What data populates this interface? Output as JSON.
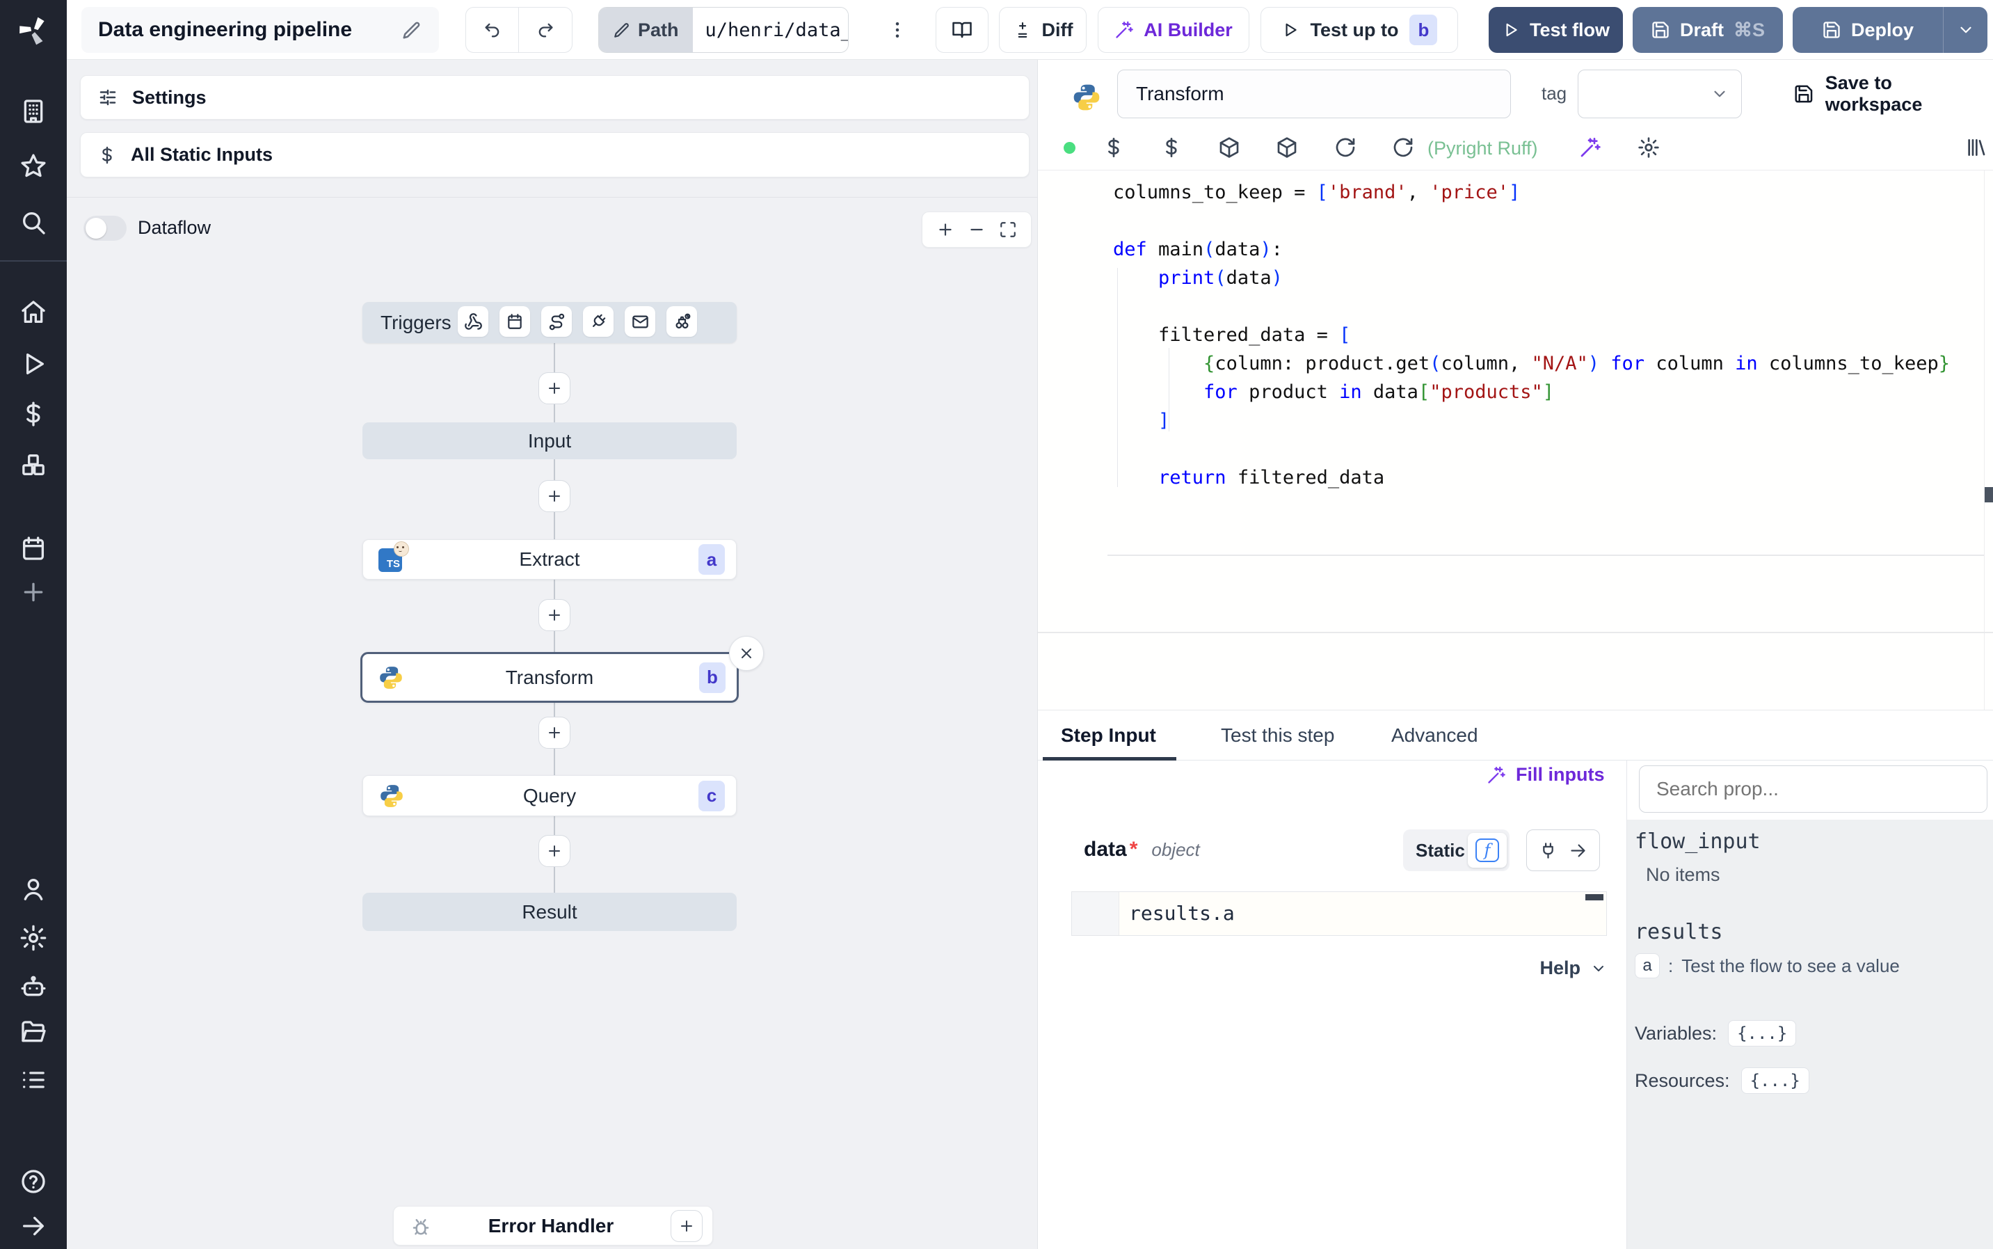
{
  "colors": {
    "test_flow_bg": "#3b4d71",
    "deploy_bg": "#5e7497",
    "ai_purple": "#6d28d9",
    "lint_green": "#79c093",
    "badge_bg": "#dbe3fc",
    "badge_text": "#4338ca",
    "status_dot": "#4ade80",
    "selected_node_border": "#51607a"
  },
  "sidebar": {
    "icons": [
      "windmill-logo",
      "workspace-building",
      "favorites-star",
      "search",
      "home",
      "runs-play",
      "variables-dollar",
      "resources-cubes",
      "schedules-calendar",
      "add-plus",
      "user",
      "settings-gear",
      "workers-robot",
      "folders",
      "audit-list",
      "help",
      "expand-arrow"
    ]
  },
  "topbar": {
    "title": "Data engineering pipeline",
    "path_label": "Path",
    "path_value": "u/henri/data_",
    "diff": "Diff",
    "ai_builder": "AI Builder",
    "test_up_to": "Test up to",
    "test_up_to_badge": "b",
    "test_flow": "Test flow",
    "draft": "Draft",
    "draft_shortcut": "⌘S",
    "deploy": "Deploy"
  },
  "flow_panel": {
    "settings": "Settings",
    "all_static_inputs": "All Static Inputs",
    "dataflow": "Dataflow",
    "trigger_icons": [
      "webhook-icon",
      "schedule-icon",
      "route-icon",
      "websocket-icon",
      "email-icon",
      "scheduled-poll-icon"
    ],
    "nodes": {
      "triggers": "Triggers",
      "input": "Input",
      "extract": {
        "label": "Extract",
        "badge": "a"
      },
      "transform": {
        "label": "Transform",
        "badge": "b"
      },
      "query": {
        "label": "Query",
        "badge": "c"
      },
      "result": "Result",
      "error_handler": "Error Handler"
    }
  },
  "editor": {
    "step_name": "Transform",
    "tag_label": "tag",
    "save_label": "Save to workspace",
    "lint": "(Pyright Ruff)",
    "toolbar_icons": [
      "status-dot",
      "variable-dollar",
      "variable-dollar-2",
      "package-box",
      "package-box-2",
      "reload",
      "reload-2",
      "ai-wand",
      "gear",
      "library-columns"
    ],
    "code_lines": [
      [
        [
          "columns_to_keep = ",
          "pl"
        ],
        [
          "[",
          "b1"
        ],
        [
          "'brand'",
          "str"
        ],
        [
          ", ",
          "pl"
        ],
        [
          "'price'",
          "str"
        ],
        [
          "]",
          "b1"
        ]
      ],
      [],
      [
        [
          "def",
          "kw"
        ],
        [
          " main",
          "pl"
        ],
        [
          "(",
          "b1"
        ],
        [
          "data",
          "pl"
        ],
        [
          ")",
          "b1"
        ],
        [
          ":",
          "pl"
        ]
      ],
      [
        [
          "    ",
          "pl"
        ],
        [
          "print",
          "kw"
        ],
        [
          "(",
          "b1"
        ],
        [
          "data",
          "pl"
        ],
        [
          ")",
          "b1"
        ]
      ],
      [],
      [
        [
          "    filtered_data = ",
          "pl"
        ],
        [
          "[",
          "b1"
        ]
      ],
      [
        [
          "        ",
          "pl"
        ],
        [
          "{",
          "b2"
        ],
        [
          "column: product.get",
          "pl"
        ],
        [
          "(",
          "b1"
        ],
        [
          "column, ",
          "pl"
        ],
        [
          "\"N/A\"",
          "str"
        ],
        [
          ")",
          "b1"
        ],
        [
          " ",
          "pl"
        ],
        [
          "for",
          "kw"
        ],
        [
          " column ",
          "pl"
        ],
        [
          "in",
          "kw"
        ],
        [
          " columns_to_keep",
          "pl"
        ],
        [
          "}",
          "b2"
        ]
      ],
      [
        [
          "        ",
          "pl"
        ],
        [
          "for",
          "kw"
        ],
        [
          " product ",
          "pl"
        ],
        [
          "in",
          "kw"
        ],
        [
          " data",
          "pl"
        ],
        [
          "[",
          "b2"
        ],
        [
          "\"products\"",
          "str"
        ],
        [
          "]",
          "b2"
        ]
      ],
      [
        [
          "    ",
          "pl"
        ],
        [
          "]",
          "b1"
        ]
      ],
      [],
      [
        [
          "    ",
          "pl"
        ],
        [
          "return",
          "kw"
        ],
        [
          " filtered_data",
          "pl"
        ]
      ]
    ]
  },
  "tabs": {
    "items": [
      {
        "label": "Step Input",
        "active": true
      },
      {
        "label": "Test this step",
        "active": false
      },
      {
        "label": "Advanced",
        "active": false
      }
    ]
  },
  "step_input": {
    "fill_inputs": "Fill inputs",
    "field_name": "data",
    "field_required": "*",
    "field_type": "object",
    "static_label": "Static",
    "expression": "results.a",
    "help": "Help"
  },
  "context_panel": {
    "search_placeholder": "Search prop...",
    "flow_input": "flow_input",
    "no_items": "No items",
    "results": "results",
    "results_row": {
      "key": "a",
      "sep": ":",
      "hint": "Test the flow to see a value"
    },
    "variables_label": "Variables:",
    "variables_value": "{...}",
    "resources_label": "Resources:",
    "resources_value": "{...}"
  }
}
